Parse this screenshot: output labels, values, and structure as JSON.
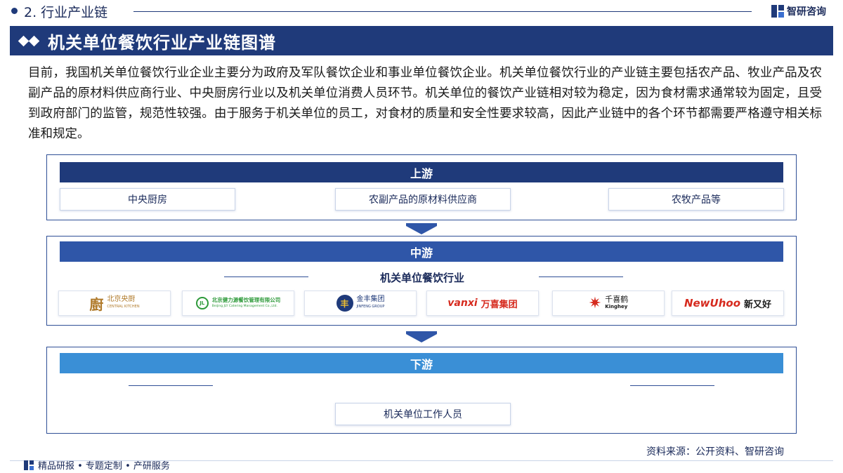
{
  "header": {
    "section_label": "2. 行业产业链",
    "brand_name": "智研咨询"
  },
  "title": "机关单位餐饮行业产业链图谱",
  "intro": "目前，我国机关单位餐饮行业企业主要分为政府及军队餐饮企业和事业单位餐饮企业。机关单位餐饮行业的产业链主要包括农产品、牧业产品及农副产品的原材料供应商行业、中央厨房行业以及机关单位消费人员环节。机关单位的餐饮产业链相对较为稳定，因为食材需求通常较为固定，且受到政府部门的监管，规范性较强。由于服务于机关单位的员工，对食材的质量和安全性要求较高，因此产业链中的各个环节都需要严格遵守相关标准和规定。",
  "upstream": {
    "label": "上游",
    "items": [
      "中央厨房",
      "农副产品的原材料供应商",
      "农牧产品等"
    ]
  },
  "midstream": {
    "label": "中游",
    "industry": "机关单位餐饮行业",
    "companies": [
      {
        "mark": "廚",
        "name": "北京央厨",
        "sub": "CENTRAL KITCHEN"
      },
      {
        "mark": "JL",
        "name": "北京健力源餐饮管理有限公司",
        "sub": "Beijing JLY Catering Management Co.,Ltd."
      },
      {
        "mark": "丰",
        "name": "金丰集团",
        "sub": "JINFENG GROUP"
      },
      {
        "mark": "vanxi",
        "name": "万喜集团",
        "sub": ""
      },
      {
        "mark": "千",
        "name": "千喜鹤",
        "sub": "Kinghey"
      },
      {
        "mark": "NewUhoo",
        "name": "新又好",
        "sub": ""
      }
    ]
  },
  "downstream": {
    "label": "下游",
    "items": [
      "机关单位工作人员"
    ]
  },
  "footer": {
    "source": "资料来源：公开资料、智研咨询",
    "tagline": "精品研报 • 专题定制 • 产研服务"
  },
  "colors": {
    "primary": "#1f3a7a",
    "mid_bar": "#2f56a8",
    "light_bar": "#3a8fd6"
  }
}
